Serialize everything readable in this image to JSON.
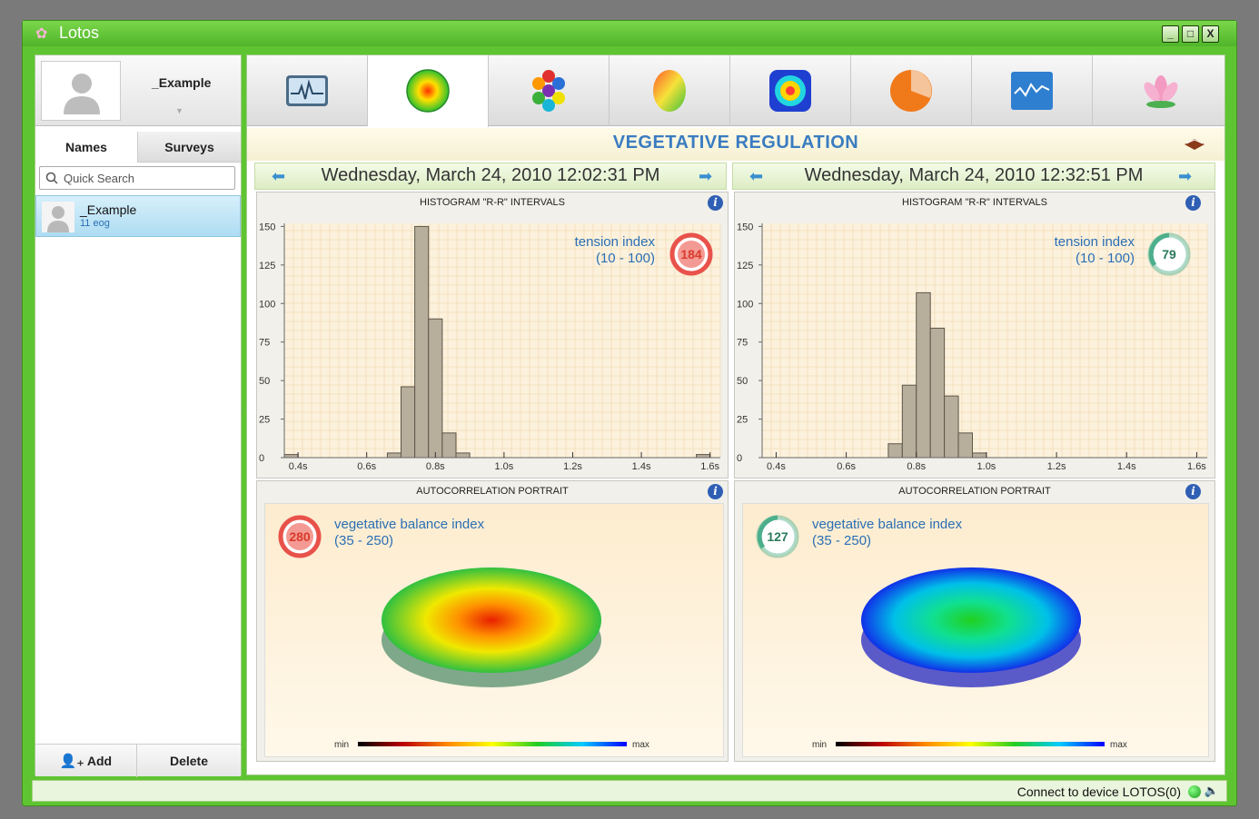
{
  "window": {
    "title": "Lotos",
    "buttons": [
      "_",
      "□",
      "X"
    ]
  },
  "profile": {
    "name": "_Example"
  },
  "left_tabs": [
    "Names",
    "Surveys"
  ],
  "search": {
    "placeholder": "Quick Search"
  },
  "patients": [
    {
      "name": "_Example",
      "sub": "11 eog"
    }
  ],
  "left_footer": {
    "add": "Add",
    "delete": "Delete"
  },
  "toolbar_icons": [
    "ecg-wave-icon",
    "vegetative-regulation-icon",
    "hexagon-cells-icon",
    "brain-map-icon",
    "chakra-icon",
    "pie-chart-icon",
    "line-graph-icon",
    "lotus-icon"
  ],
  "selected_tool": 1,
  "heading": "VEGETATIVE REGULATION",
  "panels": [
    {
      "date": "Wednesday, March 24, 2010 12:02:31 PM",
      "histogram_title": "HISTOGRAM \"R-R\" INTERVALS",
      "index_label": "tension index",
      "index_range": "(10 - 100)",
      "index_value": "184",
      "index_status": "high",
      "portrait_title": "AUTOCORRELATION PORTRAIT",
      "balance_label": "vegetative balance index",
      "balance_range": "(35 - 250)",
      "balance_value": "280",
      "balance_status": "high",
      "min": "min",
      "max": "max"
    },
    {
      "date": "Wednesday, March 24, 2010 12:32:51 PM",
      "histogram_title": "HISTOGRAM \"R-R\" INTERVALS",
      "index_label": "tension index",
      "index_range": "(10 - 100)",
      "index_value": "79",
      "index_status": "normal",
      "portrait_title": "AUTOCORRELATION PORTRAIT",
      "balance_label": "vegetative balance index",
      "balance_range": "(35 - 250)",
      "balance_value": "127",
      "balance_status": "normal",
      "min": "min",
      "max": "max"
    }
  ],
  "chart_data": [
    {
      "type": "bar",
      "title": "HISTOGRAM \"R-R\" INTERVALS",
      "x_ticks": [
        "0.4s",
        "0.6s",
        "0.8s",
        "1.0s",
        "1.2s",
        "1.4s",
        "1.6s"
      ],
      "y_ticks": [
        "0",
        "25",
        "50",
        "75",
        "100",
        "125",
        "150"
      ],
      "xlim": [
        0.36,
        1.63
      ],
      "ylim": [
        0,
        152
      ],
      "bin_width": 0.04,
      "bins": [
        {
          "x": 0.36,
          "y": 2
        },
        {
          "x": 0.66,
          "y": 3
        },
        {
          "x": 0.7,
          "y": 46
        },
        {
          "x": 0.74,
          "y": 150
        },
        {
          "x": 0.78,
          "y": 90
        },
        {
          "x": 0.82,
          "y": 16
        },
        {
          "x": 0.86,
          "y": 3
        },
        {
          "x": 1.56,
          "y": 2
        }
      ]
    },
    {
      "type": "bar",
      "title": "HISTOGRAM \"R-R\" INTERVALS",
      "x_ticks": [
        "0.4s",
        "0.6s",
        "0.8s",
        "1.0s",
        "1.2s",
        "1.4s",
        "1.6s"
      ],
      "y_ticks": [
        "0",
        "25",
        "50",
        "75",
        "100",
        "125",
        "150"
      ],
      "xlim": [
        0.36,
        1.63
      ],
      "ylim": [
        0,
        152
      ],
      "bin_width": 0.04,
      "bins": [
        {
          "x": 0.72,
          "y": 9
        },
        {
          "x": 0.76,
          "y": 47
        },
        {
          "x": 0.8,
          "y": 107
        },
        {
          "x": 0.84,
          "y": 84
        },
        {
          "x": 0.88,
          "y": 40
        },
        {
          "x": 0.92,
          "y": 16
        },
        {
          "x": 0.96,
          "y": 3
        }
      ]
    }
  ],
  "colors": {
    "high": "#e8524a",
    "normal": "#4caf8c",
    "accent": "#3a7cc1"
  },
  "status": {
    "text": "Connect to device LOTOS(0)"
  }
}
